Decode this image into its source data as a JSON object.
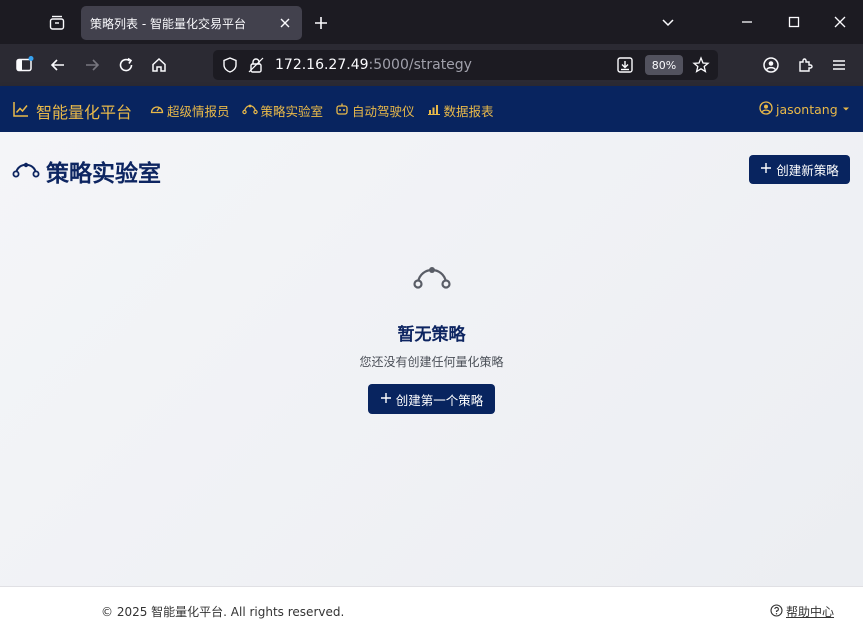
{
  "browser": {
    "tab_title": "策略列表 - 智能量化交易平台",
    "url_host": "172.16.27.49",
    "url_path": ":5000/strategy",
    "zoom": "80%"
  },
  "site": {
    "brand": "智能量化平台",
    "nav": [
      {
        "label": "超级情报员",
        "icon": "gauge-icon"
      },
      {
        "label": "策略实验室",
        "icon": "bezier-icon"
      },
      {
        "label": "自动驾驶仪",
        "icon": "robot-icon"
      },
      {
        "label": "数据报表",
        "icon": "bar-chart-icon"
      }
    ],
    "username": "jasontang"
  },
  "page": {
    "title": "策略实验室",
    "create_button": "创建新策略",
    "empty_title": "暂无策略",
    "empty_desc": "您还没有创建任何量化策略",
    "first_button": "创建第一个策略"
  },
  "footer": {
    "copyright": "© 2025 智能量化平台. All rights reserved.",
    "help": "帮助中心"
  },
  "colors": {
    "nav_bg": "#08245f",
    "accent_gold": "#e9b949",
    "title_navy": "#0d2561"
  }
}
